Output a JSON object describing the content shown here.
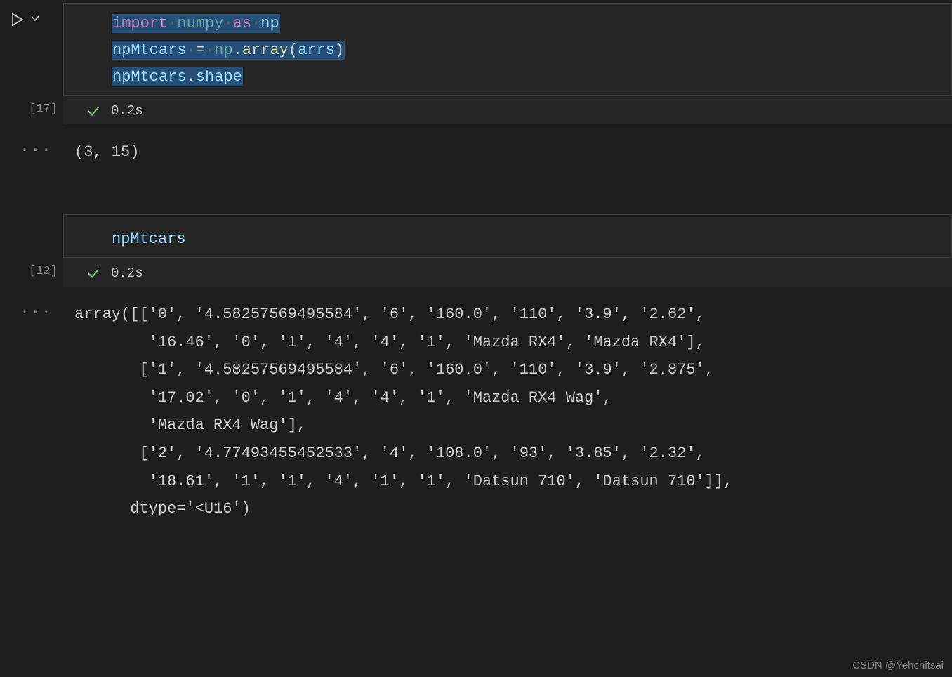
{
  "cell1": {
    "exec_count": "[17]",
    "status_time": "0.2s",
    "code": {
      "l1_import": "import",
      "l1_numpy": "numpy",
      "l1_as": "as",
      "l1_np": "np",
      "l2_var": "npMtcars",
      "l2_np": "np",
      "l2_array": "array",
      "l2_arg": "arrs",
      "l3_var": "npMtcars",
      "l3_shape": "shape"
    },
    "output_dots": "···",
    "output": "(3, 15)"
  },
  "cell2": {
    "exec_count": "[12]",
    "status_time": "0.2s",
    "code": {
      "l1_var": "npMtcars"
    },
    "output_dots": "···",
    "output_lines": [
      "array([['0', '4.58257569495584', '6', '160.0', '110', '3.9', '2.62',",
      "        '16.46', '0', '1', '4', '4', '1', 'Mazda RX4', 'Mazda RX4'],",
      "       ['1', '4.58257569495584', '6', '160.0', '110', '3.9', '2.875',",
      "        '17.02', '0', '1', '4', '4', '1', 'Mazda RX4 Wag',",
      "        'Mazda RX4 Wag'],",
      "       ['2', '4.77493455452533', '4', '108.0', '93', '3.85', '2.32',",
      "        '18.61', '1', '1', '4', '1', '1', 'Datsun 710', 'Datsun 710']],",
      "      dtype='<U16')"
    ]
  },
  "watermark": "CSDN @Yehchitsai"
}
